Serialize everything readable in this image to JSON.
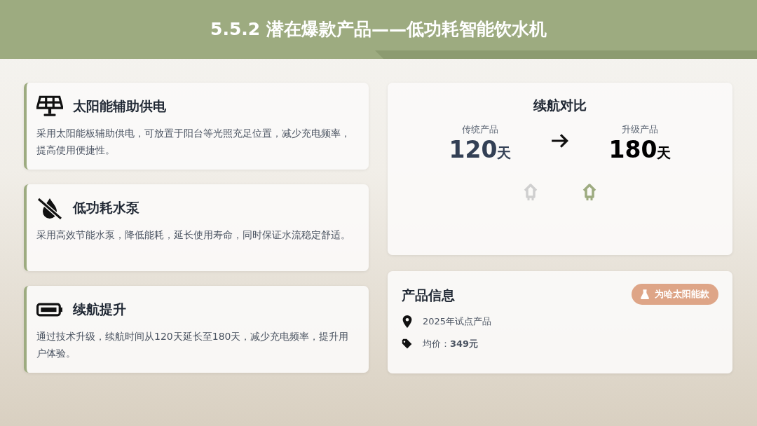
{
  "header": {
    "title": "5.5.2 潜在爆款产品——低功耗智能饮水机"
  },
  "features": [
    {
      "kind": "solar",
      "title": "太阳能辅助供电",
      "text": "采用太阳能板辅助供电，可放置于阳台等光照充足位置，减少充电频率，提高使用便捷性。"
    },
    {
      "kind": "pump",
      "title": "低功耗水泵",
      "text": "采用高效节能水泵，降低能耗，延长使用寿命，同时保证水流稳定舒适。"
    },
    {
      "kind": "battery",
      "title": "续航提升",
      "text": "通过技术升级，续航时间从120天延长至180天，减少充电频率，提升用户体验。"
    }
  ],
  "comparison": {
    "title": "续航对比",
    "items": [
      {
        "label": "传统产品",
        "value": "120",
        "unit": "天",
        "kind": "old"
      },
      {
        "label": "升级产品",
        "value": "180",
        "unit": "天",
        "kind": "new"
      }
    ]
  },
  "info": {
    "title": "产品信息",
    "badge": "为哈太阳能款",
    "rows": [
      {
        "kind": "place",
        "text": "2025年试点产品"
      },
      {
        "kind": "price",
        "text": "均价：**349元**"
      }
    ]
  }
}
